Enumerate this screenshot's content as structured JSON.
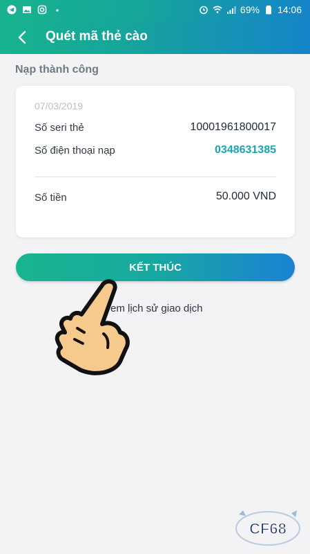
{
  "status_bar": {
    "battery_percent": "69%",
    "time": "14:06"
  },
  "app_bar": {
    "title": "Quét mã thẻ cào"
  },
  "section": {
    "title": "Nạp thành công"
  },
  "card": {
    "date": "07/03/2019",
    "rows": [
      {
        "label": "Số seri thẻ",
        "value": "10001961800017"
      },
      {
        "label": "Số điện thoại nạp",
        "value": "0348631385"
      }
    ],
    "amount": {
      "label": "Số tiền",
      "value": "50.000 VND"
    }
  },
  "finish_button": {
    "label": "KẾT THÚC"
  },
  "history_link": {
    "label": "em lịch sử giao dịch"
  },
  "colors": {
    "brand_start": "#17b38f",
    "brand_end": "#1584c9",
    "highlight": "#19a6b3"
  },
  "watermark": {
    "text": "CF68"
  }
}
